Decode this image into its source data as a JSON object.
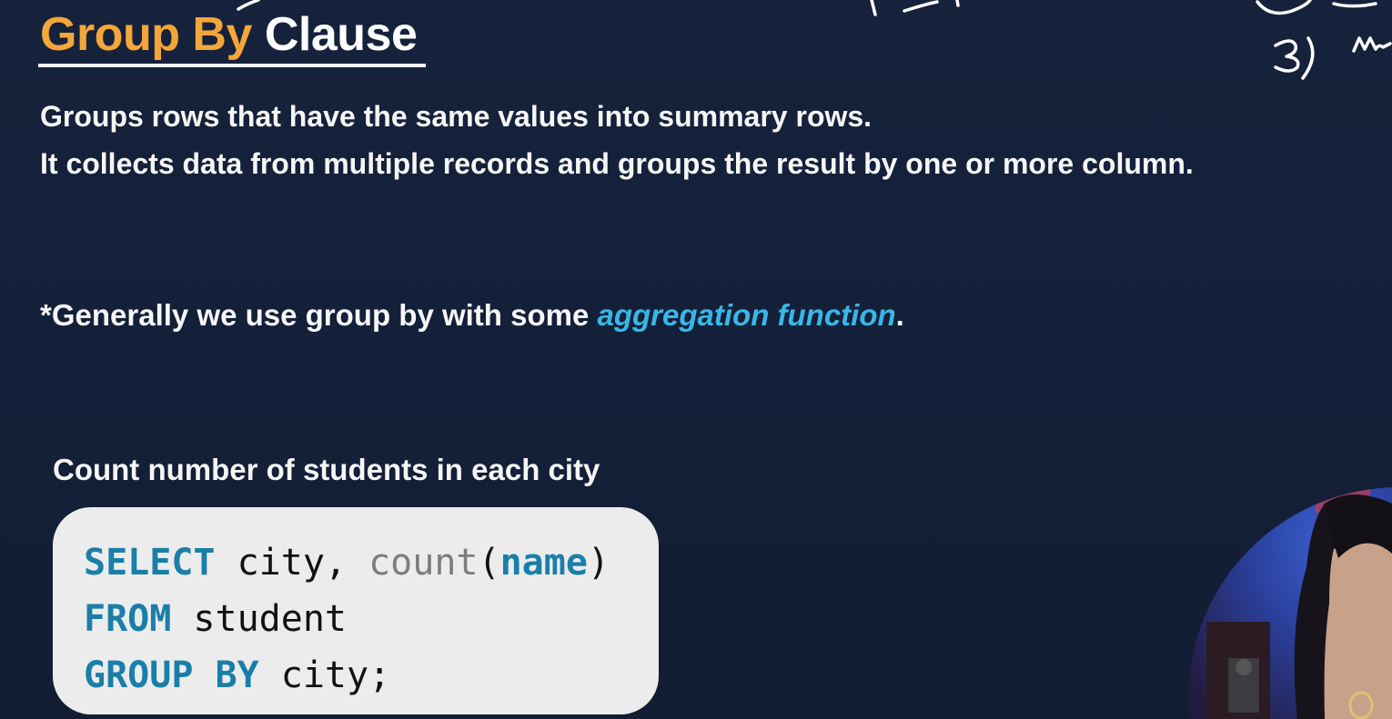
{
  "slide": {
    "title_accent": "Group By",
    "title_rest": "Clause",
    "description_lines": [
      "Groups rows that have the same values into summary rows.",
      "It collects data from multiple records and groups the result by one or more column."
    ],
    "note_prefix": "*Generally we use group by with some ",
    "note_highlight": "aggregation function",
    "note_suffix": ".",
    "example_caption": "Count number of students in each city",
    "code": {
      "line1": {
        "kw": "SELECT",
        "id": " city, ",
        "fn": "count",
        "open": "(",
        "arg": "name",
        "close": ")"
      },
      "line2": {
        "kw": "FROM",
        "id": " student"
      },
      "line3": {
        "kw": "GROUP BY",
        "id": " city;"
      }
    }
  },
  "colors": {
    "background": "#15203a",
    "title_accent": "#f5a63a",
    "highlight": "#39b7e6",
    "keyword": "#1a7fa8",
    "code_background": "#ececec"
  },
  "icons": [
    "handwritten-annotation-icon",
    "presenter-webcam-icon"
  ]
}
